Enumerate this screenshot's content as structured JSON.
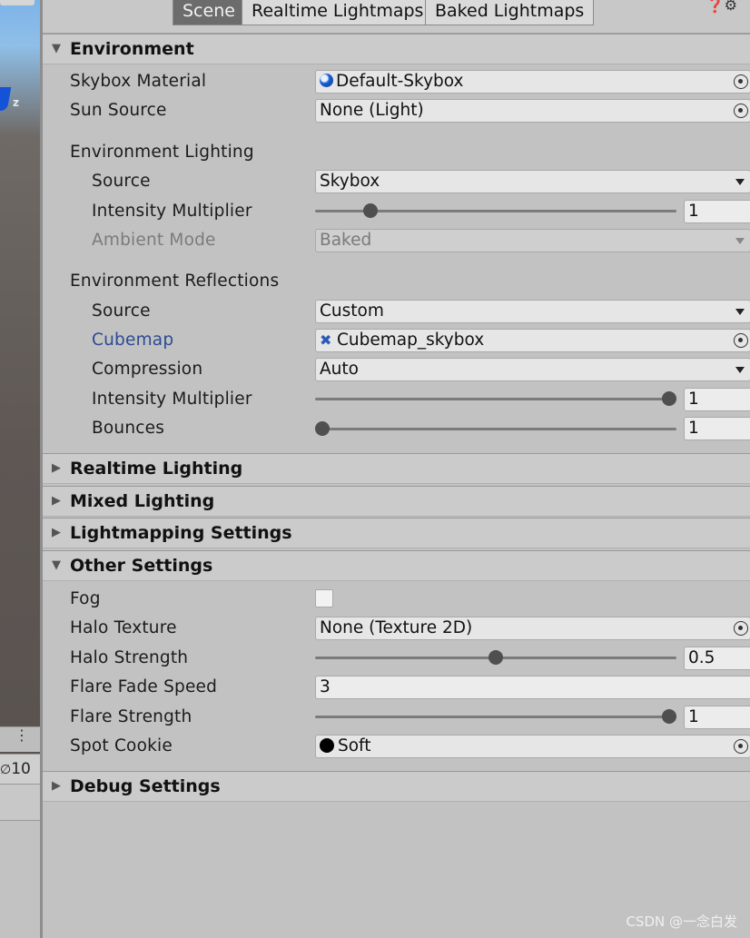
{
  "tabs": [
    {
      "label": "Scene",
      "active": true
    },
    {
      "label": "Realtime Lightmaps",
      "active": false
    },
    {
      "label": "Baked Lightmaps",
      "active": false
    }
  ],
  "scene_strip": {
    "gizmo_axis": "z",
    "count": "10",
    "menu_icon": "⋮"
  },
  "environment": {
    "header": "Environment",
    "skybox_material": {
      "label": "Skybox Material",
      "value": "Default-Skybox"
    },
    "sun_source": {
      "label": "Sun Source",
      "value": "None (Light)"
    },
    "lighting_group": "Environment Lighting",
    "lighting_source": {
      "label": "Source",
      "value": "Skybox"
    },
    "lighting_intensity": {
      "label": "Intensity Multiplier",
      "value": "1",
      "slider_fraction": 0.14
    },
    "ambient_mode": {
      "label": "Ambient Mode",
      "value": "Baked"
    },
    "reflections_group": "Environment Reflections",
    "reflection_source": {
      "label": "Source",
      "value": "Custom"
    },
    "cubemap": {
      "label": "Cubemap",
      "value": "Cubemap_skybox"
    },
    "compression": {
      "label": "Compression",
      "value": "Auto"
    },
    "reflection_intensity": {
      "label": "Intensity Multiplier",
      "value": "1",
      "slider_fraction": 1.0
    },
    "bounces": {
      "label": "Bounces",
      "value": "1",
      "slider_fraction": 0.0
    }
  },
  "collapsed_sections": {
    "realtime": "Realtime Lighting",
    "mixed": "Mixed Lighting",
    "lightmapping": "Lightmapping Settings",
    "debug": "Debug Settings"
  },
  "other": {
    "header": "Other Settings",
    "fog": {
      "label": "Fog",
      "checked": false
    },
    "halo_texture": {
      "label": "Halo Texture",
      "value": "None (Texture 2D)"
    },
    "halo_strength": {
      "label": "Halo Strength",
      "value": "0.5",
      "slider_fraction": 0.5
    },
    "flare_fade_speed": {
      "label": "Flare Fade Speed",
      "value": "3"
    },
    "flare_strength": {
      "label": "Flare Strength",
      "value": "1",
      "slider_fraction": 1.0
    },
    "spot_cookie": {
      "label": "Spot Cookie",
      "value": "Soft"
    }
  },
  "watermark": "CSDN @一念白发",
  "icons": {
    "foldout_open": "▼",
    "foldout_closed": "▶"
  }
}
